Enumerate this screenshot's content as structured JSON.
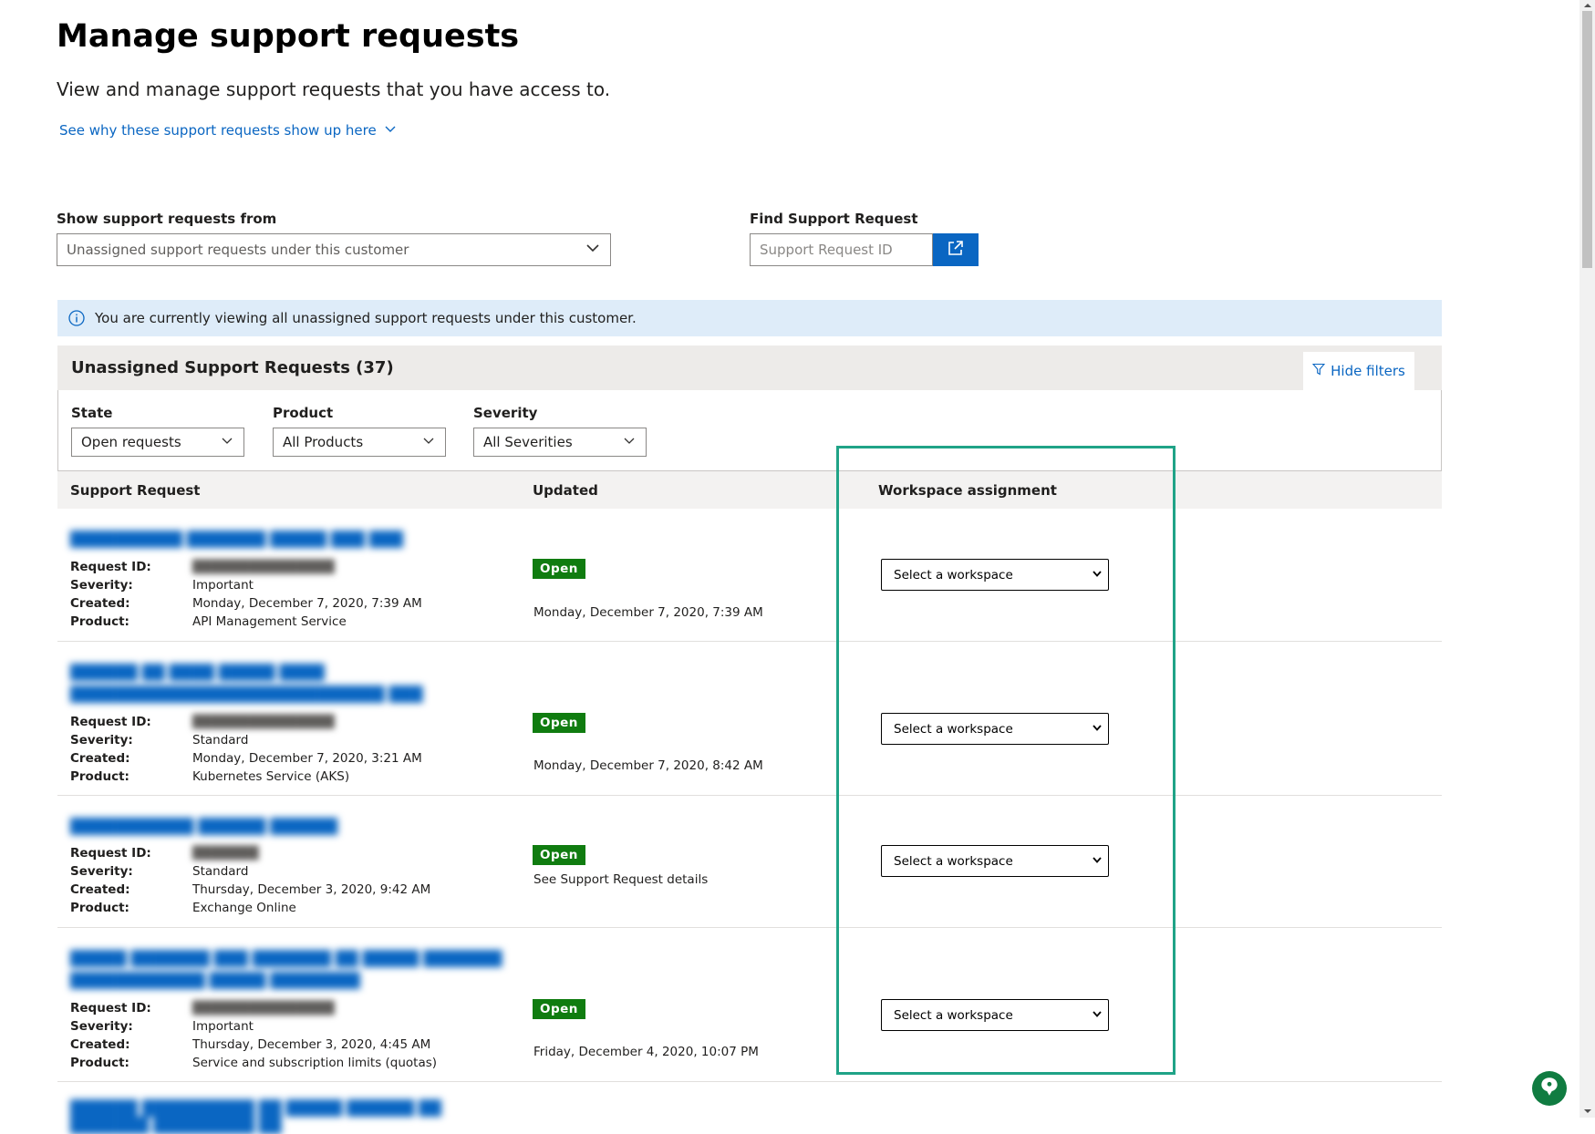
{
  "header": {
    "title": "Manage support requests",
    "subtitle": "View and manage support requests that you have access to.",
    "why_link": "See why these support requests show up here"
  },
  "source": {
    "label": "Show support requests from",
    "value": "Unassigned support requests under this customer"
  },
  "find": {
    "label": "Find Support Request",
    "placeholder": "Support Request ID"
  },
  "info_banner": "You are currently viewing all unassigned support requests under this customer.",
  "panel": {
    "title": "Unassigned Support Requests (37)",
    "hide_filters": "Hide filters"
  },
  "filters": {
    "state": {
      "label": "State",
      "value": "Open requests"
    },
    "product": {
      "label": "Product",
      "value": "All Products"
    },
    "severity": {
      "label": "Severity",
      "value": "All Severities"
    }
  },
  "columns": {
    "support_request": "Support Request",
    "updated": "Updated",
    "workspace": "Workspace assignment"
  },
  "meta_keys": {
    "request_id": "Request ID:",
    "severity": "Severity:",
    "created": "Created:",
    "product": "Product:"
  },
  "requests": [
    {
      "severity": "Important",
      "created": "Monday, December 7, 2020, 7:39 AM",
      "product": "API Management Service",
      "status": "Open",
      "updated": "Monday, December 7, 2020, 7:39 AM",
      "workspace": "Select a workspace"
    },
    {
      "severity": "Standard",
      "created": "Monday, December 7, 2020, 3:21 AM",
      "product": "Kubernetes Service (AKS)",
      "status": "Open",
      "updated": "Monday, December 7, 2020, 8:42 AM",
      "workspace": "Select a workspace"
    },
    {
      "severity": "Standard",
      "created": "Thursday, December 3, 2020, 9:42 AM",
      "product": "Exchange Online",
      "status": "Open",
      "updated": "See Support Request details",
      "workspace": "Select a workspace"
    },
    {
      "severity": "Important",
      "created": "Thursday, December 3, 2020, 4:45 AM",
      "product": "Service and subscription limits (quotas)",
      "status": "Open",
      "updated": "Friday, December 4, 2020, 10:07 PM",
      "workspace": "Select a workspace"
    }
  ],
  "colors": {
    "link": "#0a66c2",
    "status_open": "#107c10",
    "info_bg": "#deecf9",
    "highlight": "#20a387",
    "primary_button": "#0a66c2"
  },
  "icons": [
    "chevron-down-icon",
    "open-in-new-icon",
    "info-icon",
    "filter-icon",
    "chat-icon"
  ]
}
